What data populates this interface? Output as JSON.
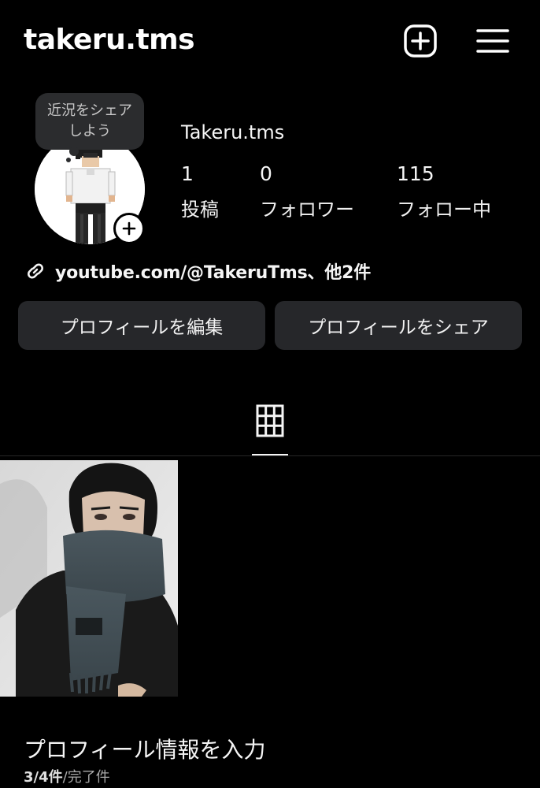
{
  "header": {
    "username": "takeru.tms",
    "add_icon": "plus-square-icon",
    "menu_icon": "hamburger-menu-icon"
  },
  "profile": {
    "note_bubble": "近況をシェアしよう",
    "display_name": "Takeru.tms",
    "avatar_icon": "pixel-avatar",
    "stats": [
      {
        "value": "1",
        "label": "投稿"
      },
      {
        "value": "0",
        "label": "フォロワー"
      },
      {
        "value": "115",
        "label": "フォロー中"
      }
    ],
    "link": "youtube.com/@TakeruTms、他2件",
    "link_icon": "link-icon"
  },
  "actions": {
    "edit_label": "プロフィールを編集",
    "share_label": "プロフィールをシェア"
  },
  "tabs": {
    "grid_icon": "grid-icon"
  },
  "completion": {
    "title": "プロフィール情報を入力",
    "count": "3/4件",
    "suffix": "/完了件"
  },
  "colors": {
    "background": "#000000",
    "button": "#26272a",
    "bubble": "#2b2c2e"
  }
}
